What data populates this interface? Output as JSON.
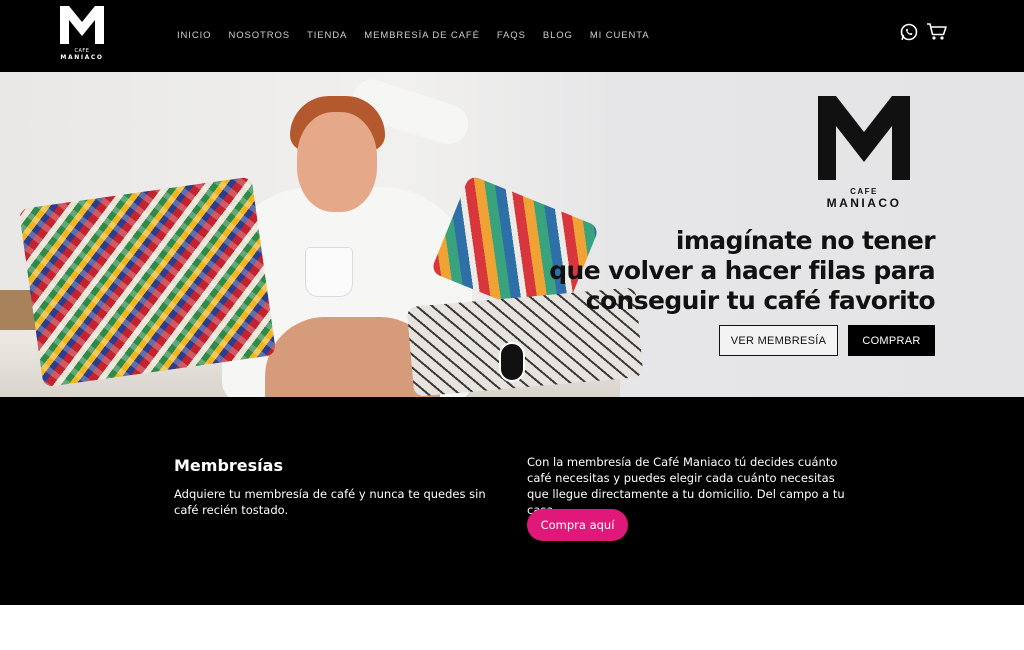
{
  "brand": {
    "cafe": "CAFE",
    "maniaco": "MANIACO",
    "accent": "#e0187a"
  },
  "nav": {
    "items": [
      {
        "label": "INICIO"
      },
      {
        "label": "NOSOTROS"
      },
      {
        "label": "TIENDA"
      },
      {
        "label": "MEMBRESÍA DE CAFÉ"
      },
      {
        "label": "FAQS"
      },
      {
        "label": "BLOG"
      },
      {
        "label": "MI CUENTA"
      }
    ],
    "icons": [
      "whatsapp-icon",
      "cart-icon"
    ]
  },
  "hero": {
    "logo_cafe": "CAFE",
    "logo_maniaco": "MANIACO",
    "headline": [
      "imagínate no tener",
      "que volver a hacer filas para",
      "conseguir tu café favorito"
    ],
    "btn_membership": "VER MEMBRESÍA",
    "btn_buy": "COMPRAR"
  },
  "memberships": {
    "title": "Membresías",
    "subtitle": "Adquiere tu membresía de café y nunca te quedes sin café recién tostado.",
    "text": "Con la membresía de Café Maniaco tú decides cuánto café necesitas y puedes elegir cada cuánto necesitas que llegue directamente a tu domicilio. Del campo a tu casa.",
    "cta": "Compra aquí"
  }
}
